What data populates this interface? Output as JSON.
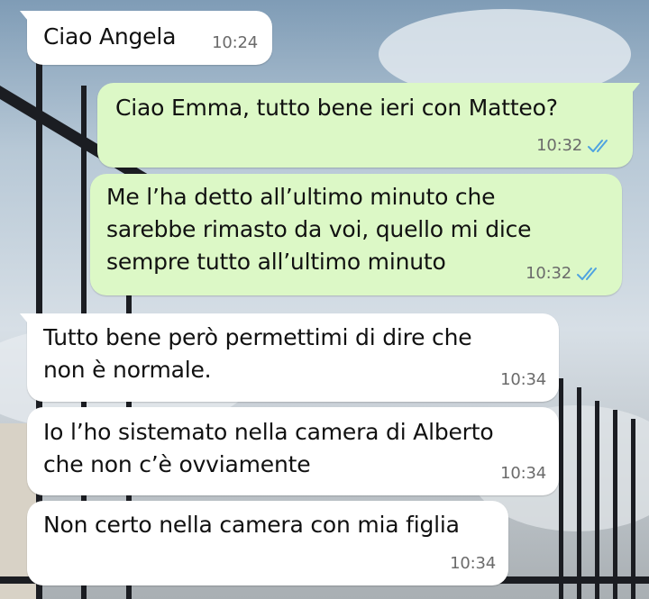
{
  "theme": {
    "incoming_bg": "#ffffff",
    "outgoing_bg": "#dcf8c6",
    "read_tick_color": "#4fa3e0",
    "timestamp_color": "#6b6b6b"
  },
  "messages": [
    {
      "direction": "incoming",
      "text": "Ciao Angela",
      "time": "10:24"
    },
    {
      "direction": "outgoing",
      "text": "Ciao Emma, tutto bene ieri con Matteo?",
      "time": "10:32",
      "status_icon": "double-check-read-icon"
    },
    {
      "direction": "outgoing",
      "text": "Me l’ha detto all’ultimo minuto che\nsarebbe rimasto da voi, quello mi dice\nsempre tutto all’ultimo minuto",
      "time": "10:32",
      "status_icon": "double-check-read-icon"
    },
    {
      "direction": "incoming",
      "text": "Tutto bene però permettimi di dire che\nnon è normale.",
      "time": "10:34"
    },
    {
      "direction": "incoming",
      "text": "Io l’ho sistemato nella camera di Alberto\nche non c’è ovviamente",
      "time": "10:34"
    },
    {
      "direction": "incoming",
      "text": "Non certo nella camera con mia figlia",
      "time": "10:34"
    }
  ]
}
